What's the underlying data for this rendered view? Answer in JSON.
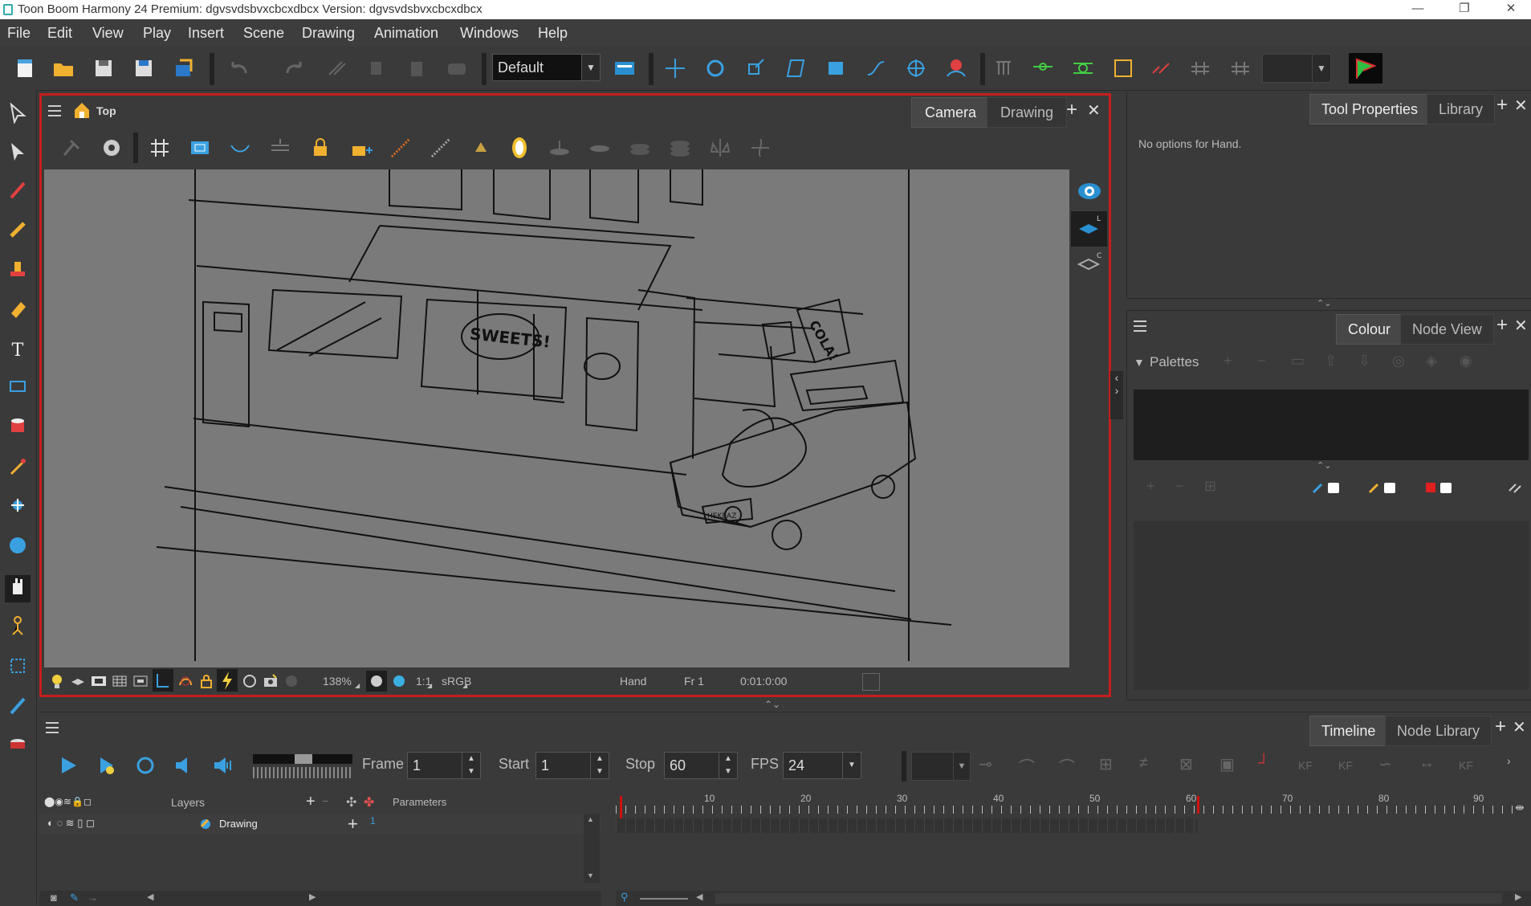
{
  "window": {
    "title": "Toon Boom Harmony 24 Premium: dgvsvdsbvxcbcxdbcx Version: dgvsvdsbvxcbcxdbcx",
    "controls": [
      "—",
      "❐",
      "✕"
    ]
  },
  "menu": [
    "File",
    "Edit",
    "View",
    "Play",
    "Insert",
    "Scene",
    "Drawing",
    "Animation",
    "Windows",
    "Help"
  ],
  "toolbar": {
    "workspace_combo": "Default"
  },
  "camera_view": {
    "breadcrumb": "Top",
    "tabs": [
      "Camera",
      "Drawing"
    ],
    "active_tab": "Camera",
    "canvas_text": {
      "sign_sweets": "SWEETS!",
      "sign_cola": "COLA!",
      "plate": "HEKEAZ"
    },
    "status": {
      "zoom": "138%",
      "ratio": "1:1",
      "colorspace": "sRGB",
      "tool": "Hand",
      "frame": "Fr 1",
      "timecode": "0:01:0:00"
    }
  },
  "tool_properties": {
    "tabs": [
      "Tool Properties",
      "Library"
    ],
    "active_tab": "Tool Properties",
    "message": "No options for Hand."
  },
  "colour_panel": {
    "tabs": [
      "Colour",
      "Node View"
    ],
    "active_tab": "Colour",
    "section": "Palettes"
  },
  "timeline": {
    "tabs": [
      "Timeline",
      "Node Library"
    ],
    "active_tab": "Timeline",
    "frame_label": "Frame",
    "frame_value": "1",
    "start_label": "Start",
    "start_value": "1",
    "stop_label": "Stop",
    "stop_value": "60",
    "fps_label": "FPS",
    "fps_value": "24",
    "layers_header": "Layers",
    "params_header": "Parameters",
    "layer_name": "Drawing",
    "layer_param": "1",
    "ruler_ticks": [
      "10",
      "20",
      "30",
      "40",
      "50",
      "60",
      "70",
      "80",
      "90"
    ]
  },
  "colors": {
    "active_view_border": "#c51d1d",
    "playhead": "#d01010",
    "background": "#3a3a3a",
    "canvas": "#7a7a7a"
  }
}
